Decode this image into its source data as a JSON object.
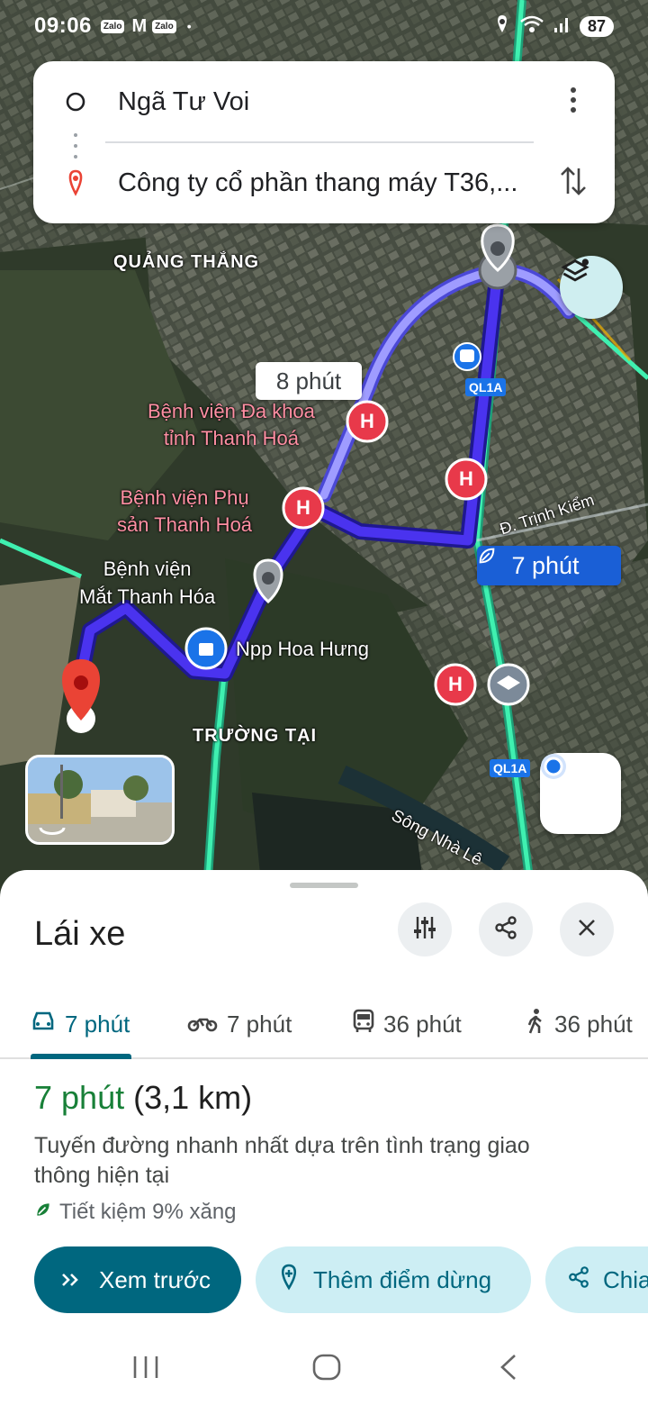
{
  "status_bar": {
    "time": "09:06",
    "apps": [
      "Zalo",
      "Zalo"
    ],
    "mail": "M",
    "dot": "•",
    "battery": "87"
  },
  "route_search": {
    "origin": "Ngã Tư Voi",
    "destination": "Công ty cổ phần thang máy T36,..."
  },
  "map": {
    "area_labels": [
      "QUẢNG THẮNG",
      "TRƯỜNG TẠI"
    ],
    "poi_labels": {
      "hospital_1": "Bệnh viện Đa khoa\ntỉnh Thanh Hoá",
      "hospital_2": "Bệnh viện Phụ\nsản Thanh Hoá",
      "hospital_3": "Bệnh viện\nMắt Thanh Hóa",
      "shop": "Npp Hoa Hưng"
    },
    "road_labels": [
      "QL1A",
      "QL1A"
    ],
    "street_label": "Đ. Trịnh Kiểm",
    "river_label": "Sông Nhà Lê",
    "alt_route_time": "8 phút",
    "main_route_time": "7 phút",
    "hospital_marker": "H",
    "colors": {
      "route_main": "#3b2cf0",
      "route_alt": "#7f7ff5",
      "road_highway": "#2ee8a0",
      "accent_teal": "#00677f",
      "green_text": "#188038"
    }
  },
  "sheet": {
    "title": "Lái xe",
    "tabs": [
      {
        "label": "7 phút",
        "icon": "car-icon"
      },
      {
        "label": "7 phút",
        "icon": "motorbike-icon"
      },
      {
        "label": "36 phút",
        "icon": "transit-icon"
      },
      {
        "label": "36 phút",
        "icon": "walk-icon"
      }
    ],
    "summary_time": "7 phút",
    "summary_distance": "(3,1 km)",
    "description": "Tuyến đường nhanh nhất dựa trên tình trạng giao thông hiện tại",
    "fuel_note": "Tiết kiệm 9% xăng",
    "preview_button": "Xem trước",
    "add_stop_button": "Thêm điểm dừng",
    "share_button": "Chia sẻ"
  }
}
